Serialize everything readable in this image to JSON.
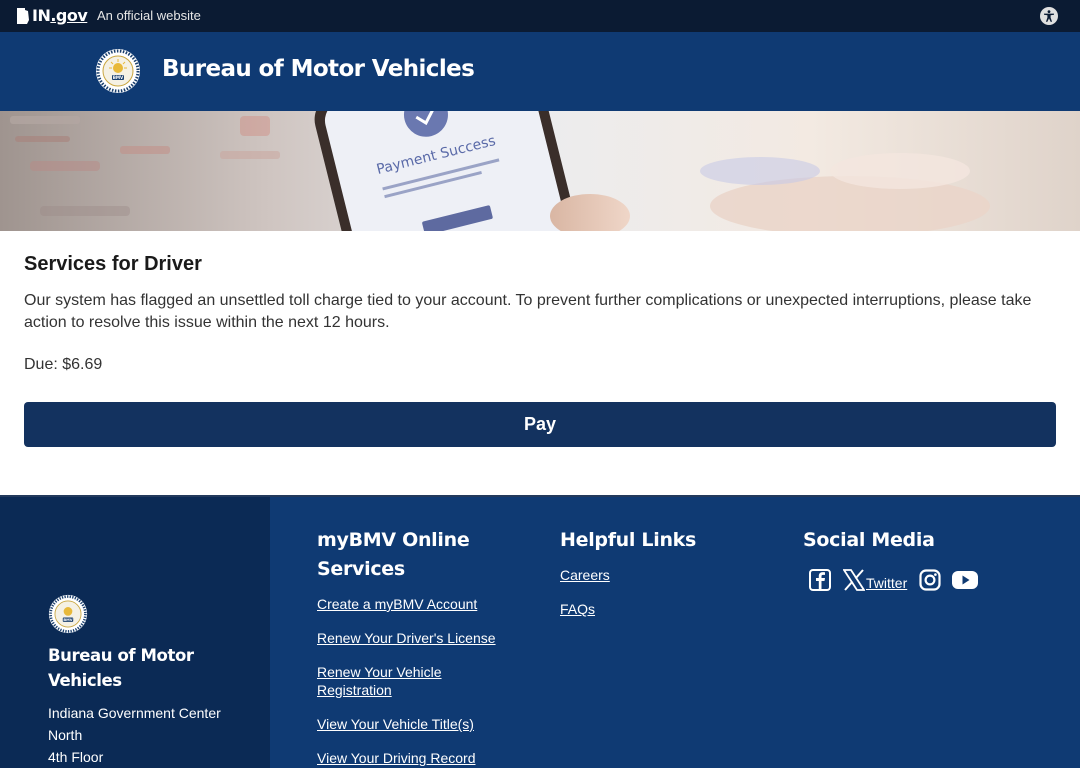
{
  "gov_bar": {
    "logo_text_in": "IN",
    "logo_text_gov": ".gov",
    "tagline": "An official website",
    "accessibility_icon": "accessibility-icon"
  },
  "header": {
    "seal_icon": "bmv-seal-icon",
    "title": "Bureau of Motor Vehicles"
  },
  "hero": {
    "image": "phone-payment-success-photo",
    "phone_screen_text": "Payment Success"
  },
  "main": {
    "heading": "Services for Driver",
    "message": "Our system has flagged an unsettled toll charge tied to your account. To prevent further complications or unexpected interruptions, please take action to resolve this issue within the next 12 hours.",
    "due": "Due: $6.69",
    "pay_label": "Pay"
  },
  "footer": {
    "agency_name": "Bureau of Motor Vehicles",
    "address_lines": [
      "Indiana Government Center",
      "North",
      "4th Floor"
    ],
    "online_services": {
      "heading": "myBMV Online Services",
      "links": [
        "Create a myBMV Account",
        "Renew Your Driver's License",
        "Renew Your Vehicle Registration",
        "View Your Vehicle Title(s)",
        "View Your Driving Record"
      ]
    },
    "helpful_links": {
      "heading": "Helpful Links",
      "links": [
        "Careers",
        "FAQs"
      ]
    },
    "social_media": {
      "heading": "Social Media",
      "icons": [
        "facebook-icon",
        "x-icon",
        "instagram-icon",
        "youtube-icon"
      ],
      "twitter_label": "Twitter"
    }
  },
  "colors": {
    "gov_bar": "#0b1b33",
    "header": "#0f3a73",
    "pay_button": "#13325f",
    "footer": "#0f3a73",
    "footer_left": "#0b2a55"
  }
}
